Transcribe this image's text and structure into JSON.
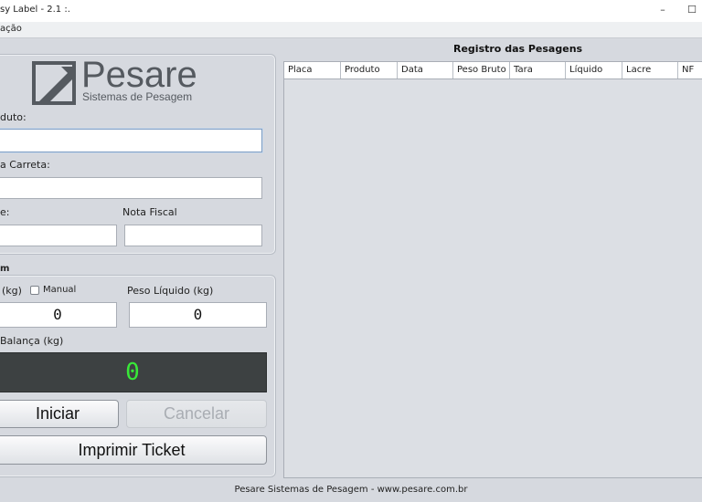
{
  "window": {
    "title": "sy Label - 2.1 :.",
    "minimize": "–",
    "maximize": "☐"
  },
  "menubar": {
    "item": "ação"
  },
  "logo": {
    "brand": "Pesare",
    "tagline": "Sistemas de Pesagem"
  },
  "form": {
    "produto_label": "duto:",
    "carreta_label": "a Carreta:",
    "lacre_label": "e:",
    "nota_fiscal_label": "Nota Fiscal",
    "produto_value": "",
    "carreta_value": "",
    "lacre_value": "",
    "nota_fiscal_value": ""
  },
  "pesagem": {
    "section_label": "m",
    "tara_label": "(kg)",
    "manual_label": "Manual",
    "liquido_label": "Peso Líquido (kg)",
    "tara_value": "0",
    "liquido_value": "0",
    "balanca_label": "Balança (kg)",
    "balanca_value": "0"
  },
  "buttons": {
    "iniciar": "Iniciar",
    "cancelar": "Cancelar",
    "imprimir": "Imprimir Ticket"
  },
  "registro": {
    "title": "Registro das Pesagens",
    "columns": [
      "Placa",
      "Produto",
      "Data",
      "Peso Bruto",
      "Tara",
      "Líquido",
      "Lacre",
      "NF"
    ]
  },
  "footer": {
    "text": "Pesare Sistemas de Pesagem - www.pesare.com.br"
  },
  "colors": {
    "display_bg": "#3d4142",
    "display_digits": "#38e838",
    "logo_gray": "#555a60"
  }
}
